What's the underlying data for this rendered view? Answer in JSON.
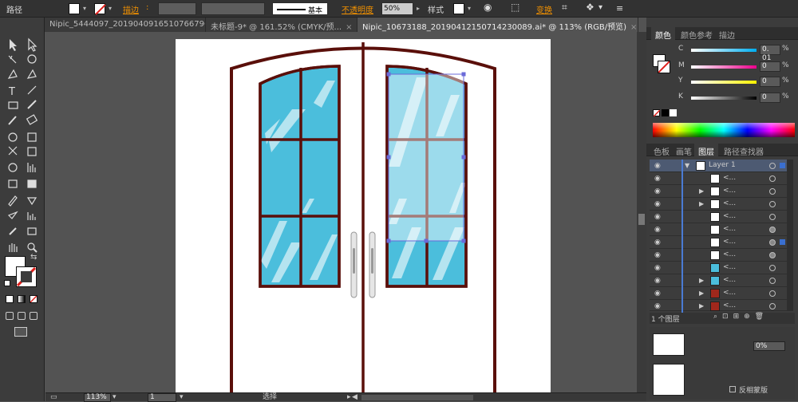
{
  "control_bar": {
    "selection_label": "路径",
    "stroke_label": "描边",
    "stroke_style": "基本",
    "opacity_label": "不透明度",
    "opacity_value": "50%",
    "style_label": "样式",
    "transform_label": "变换"
  },
  "tabs": [
    {
      "label": "Nipic_5444097_20190409165107667964.ai*",
      "close": "×"
    },
    {
      "label": "未标题-9* @ 161.52% (CMYK/预...",
      "close": "×"
    },
    {
      "label": "Nipic_10673188_20190412150714230089.ai* @ 113% (RGB/预览)",
      "close": "×"
    }
  ],
  "color_panel": {
    "tabs": [
      "颜色",
      "颜色参考",
      "描边"
    ],
    "sliders": [
      {
        "channel": "C",
        "value": "0. 01",
        "unit": "%",
        "gradient": "linear-gradient(to right,#fff,#00aeef)"
      },
      {
        "channel": "M",
        "value": "0",
        "unit": "%",
        "gradient": "linear-gradient(to right,#fff,#ec008c)"
      },
      {
        "channel": "Y",
        "value": "0",
        "unit": "%",
        "gradient": "linear-gradient(to right,#fff,#fff200)"
      },
      {
        "channel": "K",
        "value": "0",
        "unit": "%",
        "gradient": "linear-gradient(to right,#fff,#000)"
      }
    ]
  },
  "layers_panel": {
    "tabs": [
      "色板",
      "画笔",
      "图层",
      "路径查找器"
    ],
    "layer_name": "Layer 1",
    "sublayer_label": "<...",
    "rows": 12,
    "footer": "1 个图层"
  },
  "lower_panel": {
    "label": "反相蒙版",
    "opacity": "0%"
  },
  "status_bar": {
    "zoom": "113%",
    "page": "1",
    "tool": "选择"
  },
  "colors": {
    "door_frame": "#5a0f0a",
    "glass": "#4bbedc",
    "glass_highlight": "#b5e4f0",
    "selection": "#6a6ad8"
  }
}
